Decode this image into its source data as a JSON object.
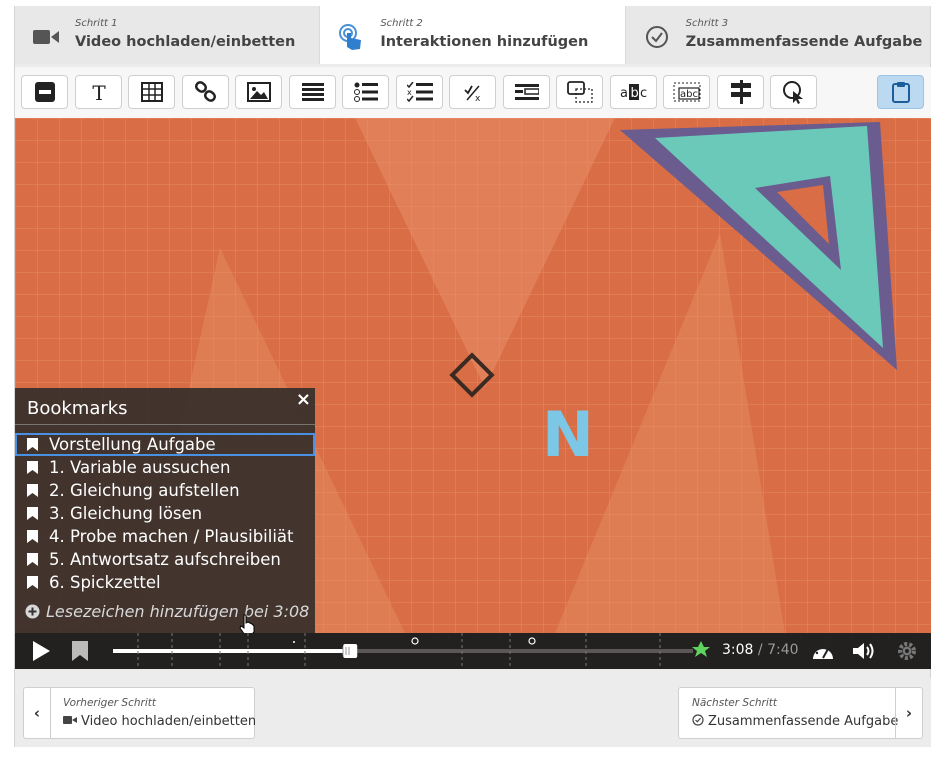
{
  "steps": [
    {
      "small": "Schritt 1",
      "label": "Video hochladen/einbetten",
      "icon": "video-camera-icon",
      "active": false
    },
    {
      "small": "Schritt 2",
      "label": "Interaktionen hinzufügen",
      "icon": "touch-pointer-icon",
      "active": true
    },
    {
      "small": "Schritt 3",
      "label": "Zusammenfassende Aufgabe",
      "icon": "check-circle-icon",
      "active": false
    }
  ],
  "toolbar": {
    "icons": [
      "label-icon",
      "text-icon",
      "table-icon",
      "link-icon",
      "image-icon",
      "statements-icon",
      "single-choice-icon",
      "multiple-choice-icon",
      "true-false-icon",
      "fill-blanks-icon",
      "drag-drop-icon",
      "mark-words-icon",
      "drag-text-icon",
      "crossroads-icon",
      "navigation-hotspot-icon",
      "paste-clipboard-icon"
    ]
  },
  "bookmarks": {
    "title": "Bookmarks",
    "close": "×",
    "items": [
      "Vorstellung Aufgabe",
      "1. Variable aussuchen",
      "2. Gleichung aufstellen",
      "3. Gleichung lösen",
      "4. Probe machen / Plausibiliät",
      "5. Antwortsatz aufschreiben",
      "6. Spickzettel"
    ],
    "selected_index": 0,
    "add_label": "Lesezeichen hinzufügen bei 3:08"
  },
  "video": {
    "overlay_letter": "N",
    "bg_color": "#d86d46",
    "accent_color": "#5cc0c0"
  },
  "player": {
    "current_time": "3:08",
    "total_time": "7:40",
    "progress": 0.409
  },
  "nav": {
    "prev_small": "Vorheriger Schritt",
    "prev_label": "Video hochladen/einbetten",
    "next_small": "Nächster Schritt",
    "next_label": "Zusammenfassende Aufgabe"
  }
}
